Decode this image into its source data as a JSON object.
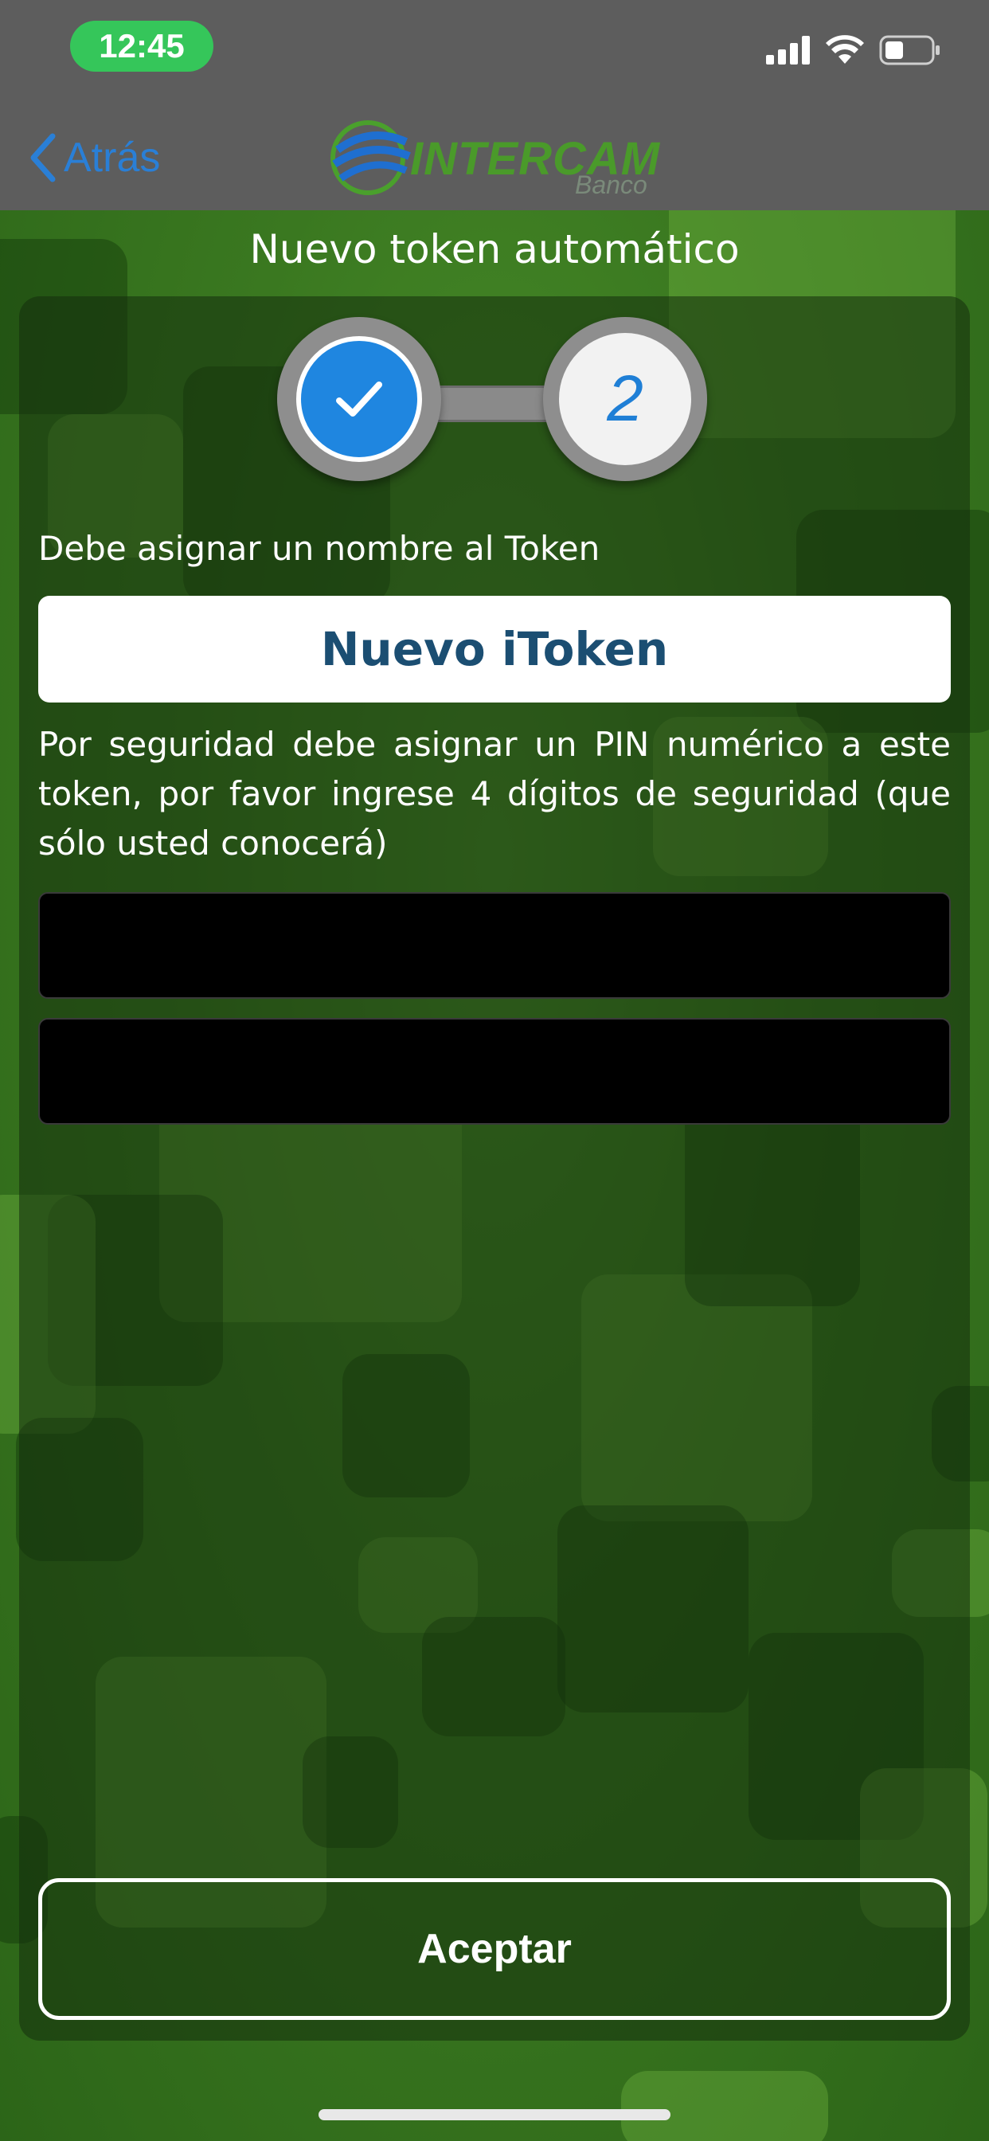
{
  "status_bar": {
    "time": "12:45"
  },
  "nav": {
    "back_label": "Atrás",
    "logo_text": "INTERCAM",
    "logo_sub": "Banco"
  },
  "screen_title": "Nuevo token automático",
  "stepper": {
    "step2_label": "2"
  },
  "form": {
    "name_label": "Debe asignar un nombre al Token",
    "name_value": "Nuevo iToken",
    "pin_description": "Por seguridad debe asignar un PIN numérico a este token, por favor ingrese 4 dígitos de seguridad (que sólo usted conocerá)",
    "pin_value": "",
    "pin_confirm_value": ""
  },
  "actions": {
    "accept_label": "Aceptar"
  },
  "colors": {
    "accent_blue": "#1f86e0",
    "nav_gray": "#5d5d5d",
    "time_green": "#35c65a",
    "field_text": "#1b4e72"
  }
}
